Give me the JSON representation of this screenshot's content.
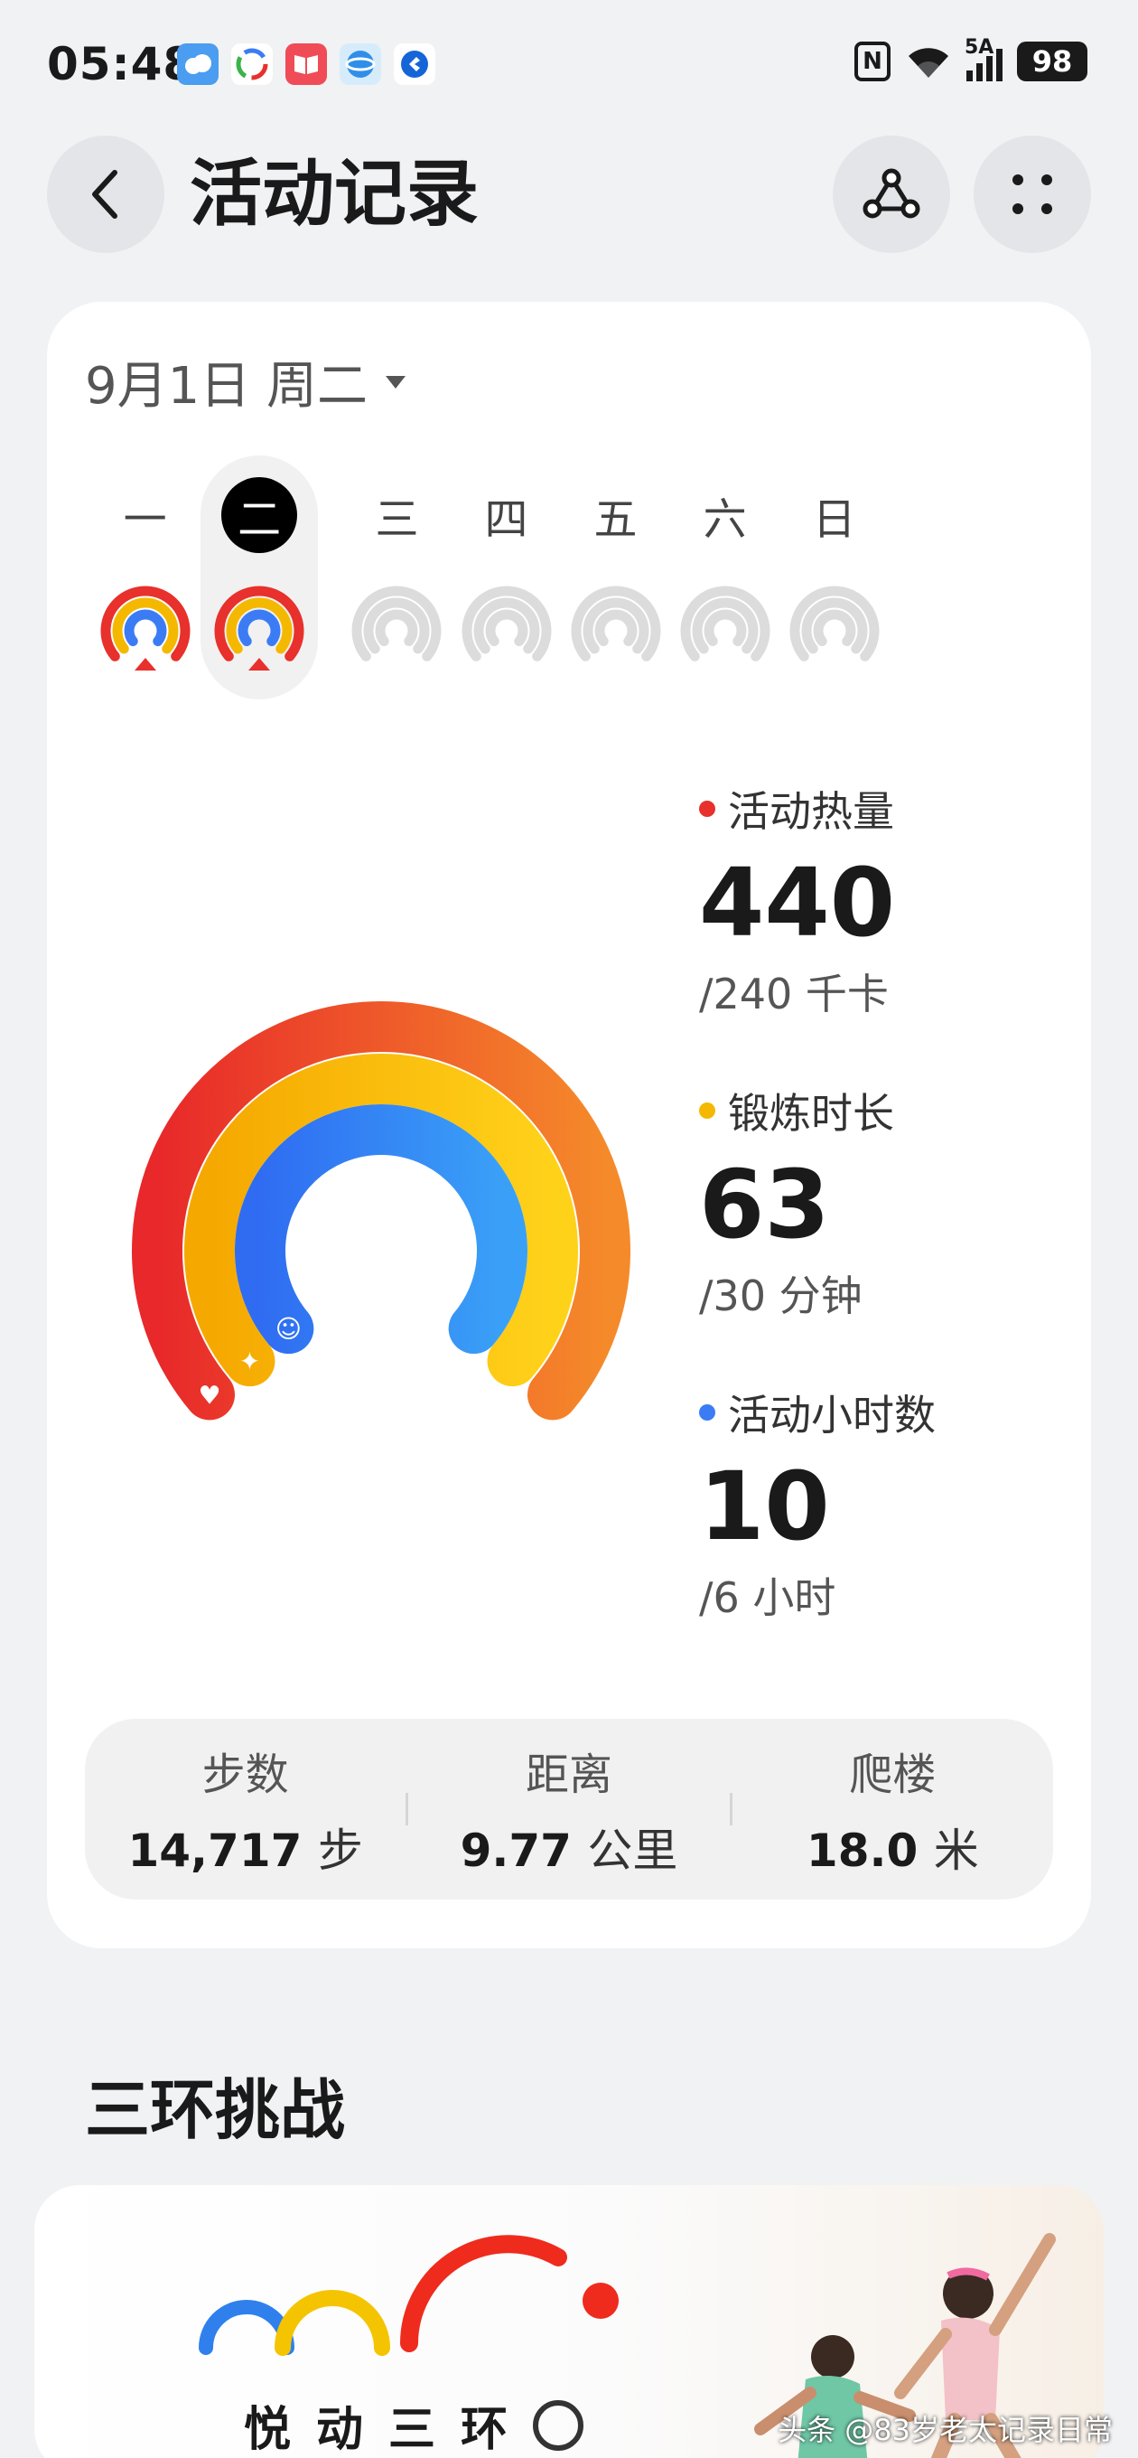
{
  "status_bar": {
    "time": "05:48",
    "network": "5A",
    "battery": "98",
    "icons": [
      "weather-icon",
      "photos-icon",
      "book-icon",
      "browser-icon",
      "app-icon",
      "nfc-icon",
      "wifi-icon",
      "signal-icon"
    ]
  },
  "header": {
    "title": "活动记录",
    "back_icon": "chevron-left-icon",
    "share_icon": "share-icon",
    "more_icon": "grid-dots-icon"
  },
  "date_picker": {
    "label": "9月1日 周二"
  },
  "week": {
    "days": [
      {
        "label": "一",
        "active": true,
        "selected": false
      },
      {
        "label": "二",
        "active": true,
        "selected": true
      },
      {
        "label": "三",
        "active": false,
        "selected": false
      },
      {
        "label": "四",
        "active": false,
        "selected": false
      },
      {
        "label": "五",
        "active": false,
        "selected": false
      },
      {
        "label": "六",
        "active": false,
        "selected": false
      },
      {
        "label": "日",
        "active": false,
        "selected": false
      }
    ]
  },
  "metrics": [
    {
      "label": "活动热量",
      "value": "440",
      "goal": "/240 千卡",
      "color": "#e8302c",
      "progress": 1.0
    },
    {
      "label": "锻炼时长",
      "value": "63",
      "goal": "/30 分钟",
      "color": "#f5b800",
      "progress": 1.0
    },
    {
      "label": "活动小时数",
      "value": "10",
      "goal": "/6 小时",
      "color": "#3b7cf5",
      "progress": 1.0
    }
  ],
  "stats": [
    {
      "label": "步数",
      "value": "14,717",
      "unit": "步"
    },
    {
      "label": "距离",
      "value": "9.77",
      "unit": "公里"
    },
    {
      "label": "爬楼",
      "value": "18.0",
      "unit": "米"
    }
  ],
  "challenge": {
    "section_title": "三环挑战",
    "promo_chars": [
      "悦",
      "动",
      "三",
      "环"
    ]
  },
  "watermark": "头条 @83岁老太记录日常"
}
